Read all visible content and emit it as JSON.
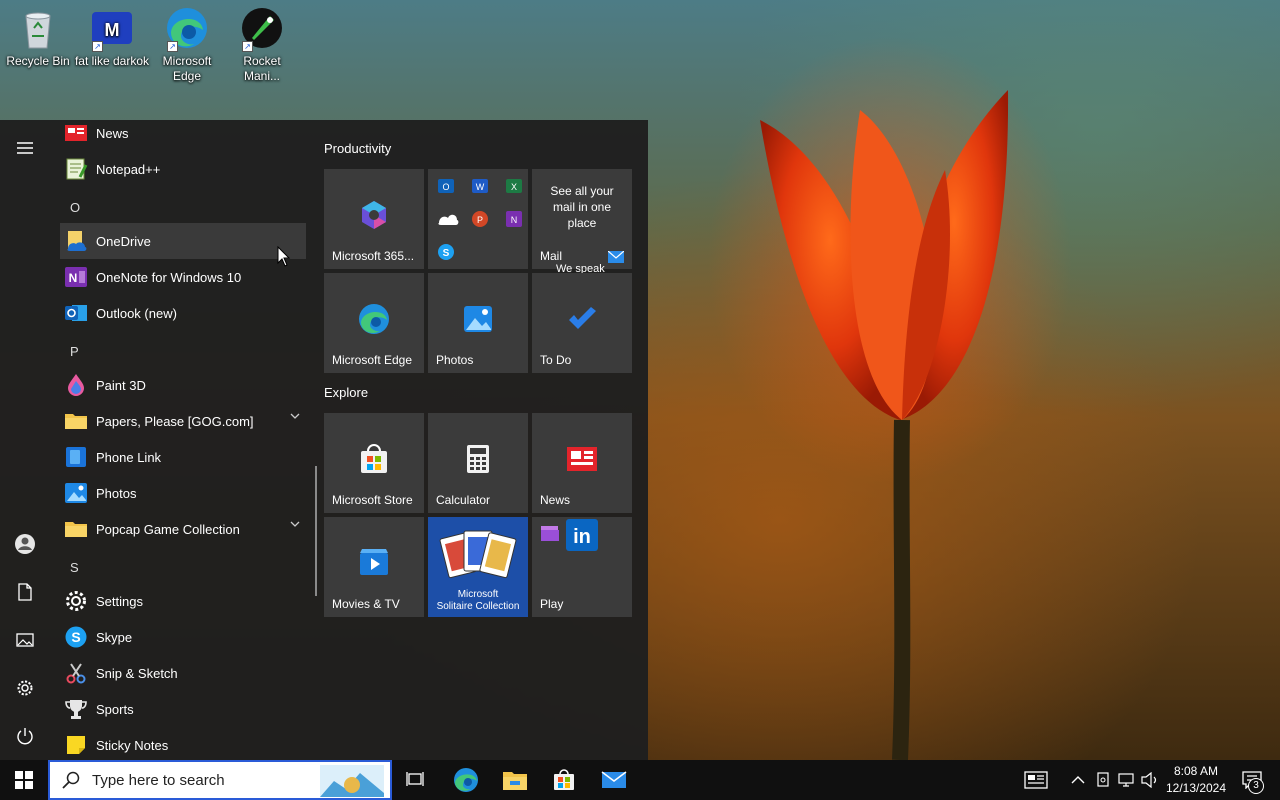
{
  "desktop": {
    "icons": [
      {
        "label": "Recycle Bin"
      },
      {
        "label": "fat like darkok"
      },
      {
        "label": "Microsoft Edge"
      },
      {
        "label": "Rocket Mani..."
      }
    ]
  },
  "start_menu": {
    "app_list": [
      {
        "type": "app",
        "label": "News",
        "icon": "news-icon"
      },
      {
        "type": "app",
        "label": "Notepad++",
        "icon": "notepadpp-icon"
      },
      {
        "type": "letter",
        "label": "O"
      },
      {
        "type": "app",
        "label": "OneDrive",
        "icon": "onedrive-icon",
        "hover": true
      },
      {
        "type": "app",
        "label": "OneNote for Windows 10",
        "icon": "onenote-icon"
      },
      {
        "type": "app",
        "label": "Outlook (new)",
        "icon": "outlook-icon"
      },
      {
        "type": "letter",
        "label": "P"
      },
      {
        "type": "app",
        "label": "Paint 3D",
        "icon": "paint3d-icon"
      },
      {
        "type": "folder",
        "label": "Papers, Please [GOG.com]",
        "icon": "folder-icon"
      },
      {
        "type": "app",
        "label": "Phone Link",
        "icon": "phone-link-icon"
      },
      {
        "type": "app",
        "label": "Photos",
        "icon": "photos-icon"
      },
      {
        "type": "folder",
        "label": "Popcap Game Collection",
        "icon": "folder-icon"
      },
      {
        "type": "letter",
        "label": "S"
      },
      {
        "type": "app",
        "label": "Settings",
        "icon": "settings-icon"
      },
      {
        "type": "app",
        "label": "Skype",
        "icon": "skype-icon"
      },
      {
        "type": "app",
        "label": "Snip & Sketch",
        "icon": "snip-icon"
      },
      {
        "type": "app",
        "label": "Sports",
        "icon": "trophy-icon"
      },
      {
        "type": "app",
        "label": "Sticky Notes",
        "icon": "sticky-notes-icon"
      }
    ],
    "groups": [
      {
        "title": "Productivity"
      },
      {
        "title": "Explore"
      }
    ],
    "tiles": {
      "m365": "Microsoft 365...",
      "mail_text": "See all your mail in one place",
      "mail": "Mail",
      "mail_sub": "We speak",
      "edge": "Microsoft Edge",
      "photos": "Photos",
      "todo": "To Do",
      "store": "Microsoft Store",
      "calculator": "Calculator",
      "news": "News",
      "movies": "Movies & TV",
      "solitaire_line1": "Microsoft",
      "solitaire_line2": "Solitaire Collection",
      "play": "Play"
    }
  },
  "taskbar": {
    "search_placeholder": "Type here to search",
    "time": "8:08 AM",
    "date": "12/13/2024",
    "notification_count": "3"
  },
  "colors": {
    "accent": "#0078d4",
    "start_bg": "#1f1f1f",
    "tile_bg": "#3b3b3b",
    "taskbar_bg": "#101010"
  }
}
